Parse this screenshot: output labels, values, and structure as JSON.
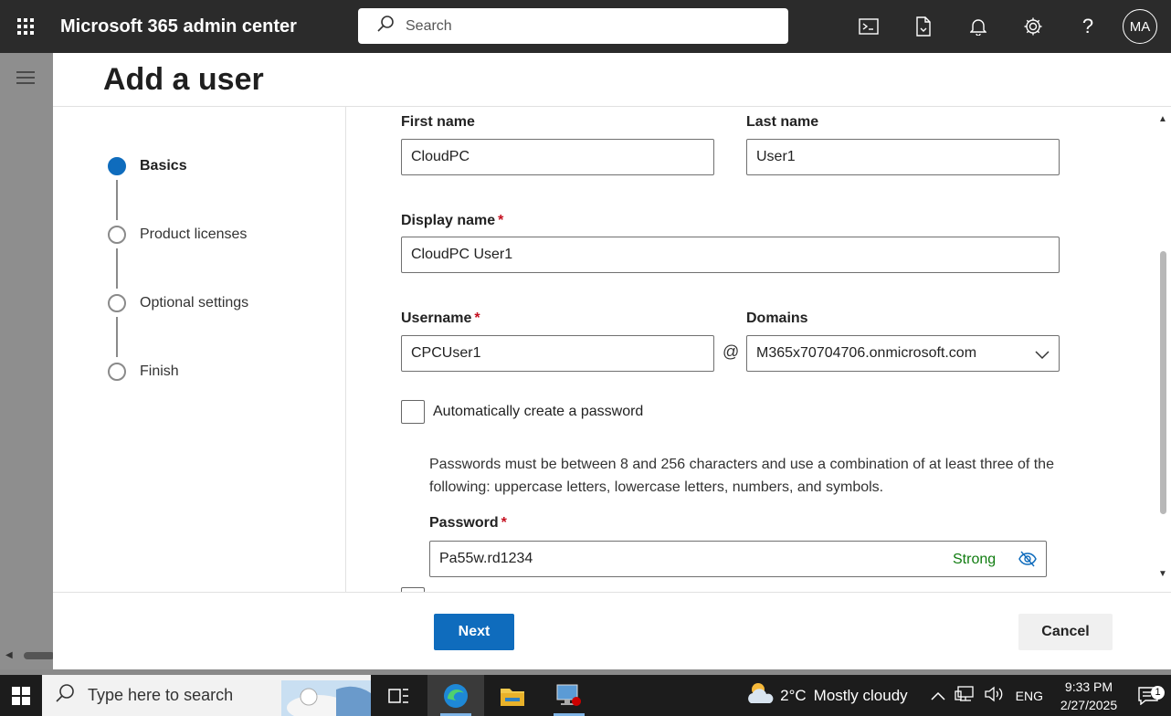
{
  "header": {
    "app_title": "Microsoft 365 admin center",
    "search_placeholder": "Search",
    "avatar_initials": "MA",
    "help_label": "?"
  },
  "page": {
    "title": "Add a user"
  },
  "steps": [
    {
      "label": "Basics",
      "state": "active"
    },
    {
      "label": "Product licenses",
      "state": "pending"
    },
    {
      "label": "Optional settings",
      "state": "pending"
    },
    {
      "label": "Finish",
      "state": "pending"
    }
  ],
  "form": {
    "first_name_label": "First name",
    "first_name_value": "CloudPC",
    "last_name_label": "Last name",
    "last_name_value": "User1",
    "display_name_label": "Display name",
    "display_name_value": "CloudPC User1",
    "username_label": "Username",
    "username_value": "CPCUser1",
    "at_symbol": "@",
    "domains_label": "Domains",
    "domains_value": "M365x70704706.onmicrosoft.com",
    "auto_password_label": "Automatically create a password",
    "auto_password_checked": false,
    "password_hint": "Passwords must be between 8 and 256 characters and use a combination of at least three of the following: uppercase letters, lowercase letters, numbers, and symbols.",
    "password_label": "Password",
    "password_value": "Pa55w.rd1234",
    "password_strength": "Strong",
    "required_marker": "*"
  },
  "footer": {
    "next_label": "Next",
    "cancel_label": "Cancel"
  },
  "taskbar": {
    "search_placeholder": "Type here to search",
    "weather_temp": "2°C",
    "weather_text": "Mostly cloudy",
    "language": "ENG",
    "time": "9:33 PM",
    "date": "2/27/2025",
    "notification_count": "1"
  },
  "colors": {
    "accent": "#0f6cbd",
    "header_bg": "#2b2b2b",
    "required": "#c50f1f",
    "strength": "#107c10"
  }
}
